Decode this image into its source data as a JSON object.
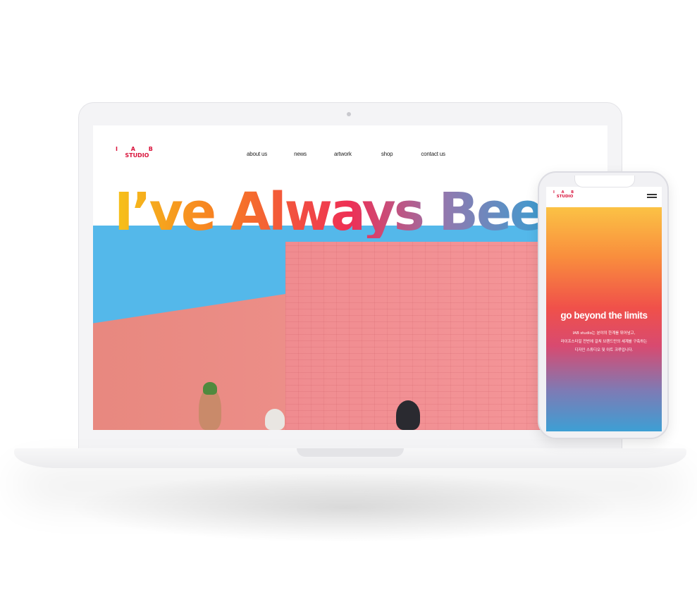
{
  "desktop": {
    "logo": {
      "top": "I A B",
      "bottom": "STUDIO"
    },
    "nav": [
      "about us",
      "news",
      "artwork",
      "shop",
      "contact us"
    ],
    "headline": "I’ve Always Bee"
  },
  "mobile": {
    "logo": {
      "top": "I A B",
      "bottom": "STUDIO"
    },
    "title": "go beyond the limits",
    "body_lines": [
      "IAB studio는 분야의 한계를 뛰어넘고,",
      "라이프스타일 전반에 걸쳐 브랜드만의 세계를 구축하는",
      "디자인 스튜디오 및 아트 크루입니다."
    ]
  },
  "colors": {
    "logo": "#d9143c",
    "sky": "#54b8ea",
    "wall": "#f08c90",
    "gradient": [
      "#f6c21a",
      "#f77d22",
      "#ee2f55",
      "#8f7ab0",
      "#3d9cd0"
    ]
  }
}
